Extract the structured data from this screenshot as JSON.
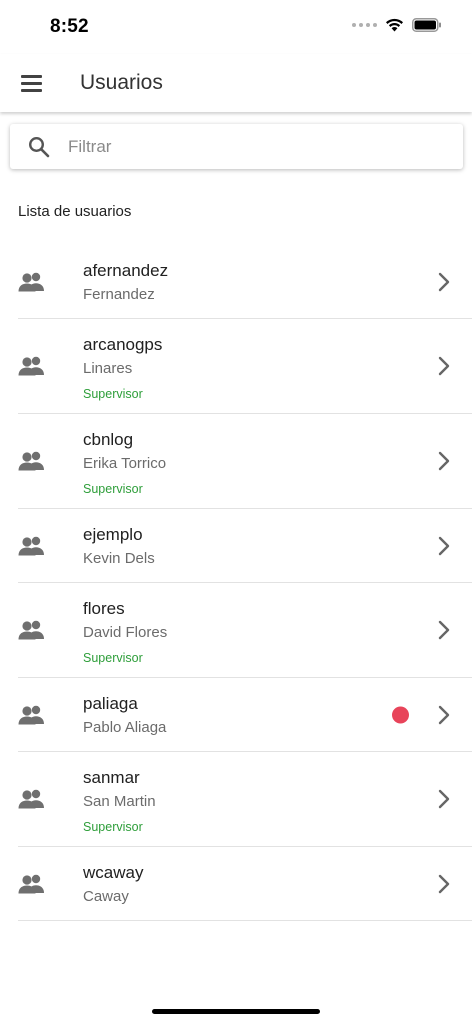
{
  "status_bar": {
    "time": "8:52"
  },
  "app_bar": {
    "title": "Usuarios",
    "menu_icon": "hamburger-menu-icon"
  },
  "search": {
    "placeholder": "Filtrar",
    "value": "",
    "icon": "search-icon"
  },
  "list": {
    "section_label": "Lista de usuarios",
    "users": [
      {
        "username": "afernandez",
        "fullname": "Fernandez",
        "role": "",
        "unread": false
      },
      {
        "username": "arcanogps",
        "fullname": "Linares",
        "role": "Supervisor",
        "unread": false
      },
      {
        "username": "cbnlog",
        "fullname": "Erika Torrico",
        "role": "Supervisor",
        "unread": false
      },
      {
        "username": "ejemplo",
        "fullname": "Kevin Dels",
        "role": "",
        "unread": false
      },
      {
        "username": "flores",
        "fullname": "David Flores",
        "role": "Supervisor",
        "unread": false
      },
      {
        "username": "paliaga",
        "fullname": "Pablo Aliaga",
        "role": "",
        "unread": true
      },
      {
        "username": "sanmar",
        "fullname": "San Martin",
        "role": "Supervisor",
        "unread": false
      },
      {
        "username": "wcaway",
        "fullname": "Caway",
        "role": "",
        "unread": false
      }
    ]
  },
  "colors": {
    "role_text": "#2e9e3a",
    "unread_dot": "#e8445a",
    "divider": "#e2e2e2"
  }
}
